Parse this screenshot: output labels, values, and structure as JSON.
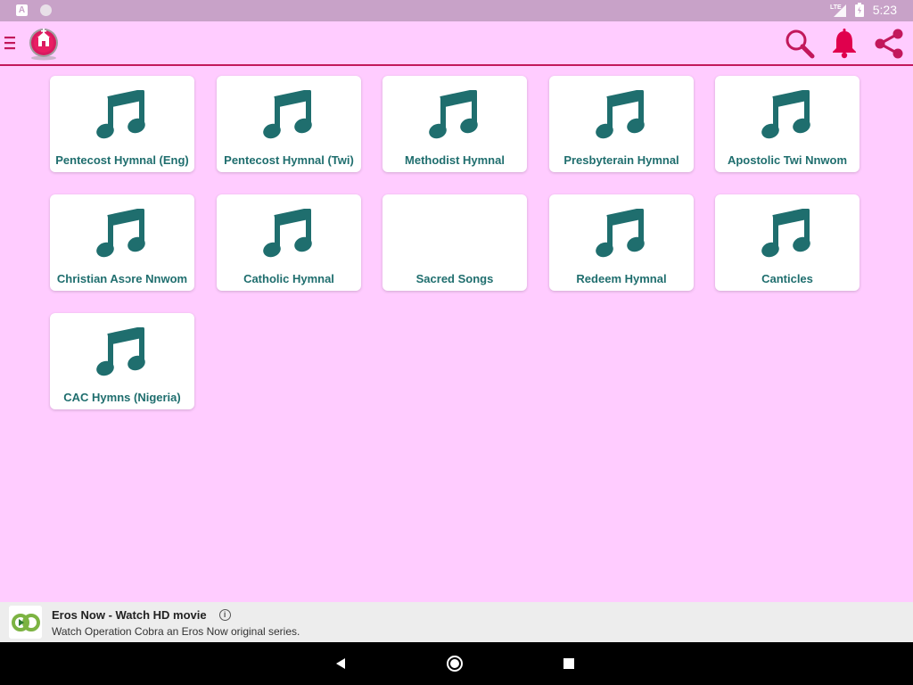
{
  "status_bar": {
    "time": "5:23",
    "network": "LTE",
    "notification_icons": [
      "app-a-icon",
      "circle-notification-icon"
    ]
  },
  "app_bar": {
    "menu_icon": "hamburger-menu-icon",
    "logo_icon": "church-logo-icon",
    "actions": [
      "search-icon",
      "bell-icon",
      "share-icon"
    ]
  },
  "hymnals": [
    {
      "label": "Pentecost Hymnal (Eng)",
      "icon": "music-note-icon"
    },
    {
      "label": "Pentecost Hymnal (Twi)",
      "icon": "music-note-icon"
    },
    {
      "label": "Methodist Hymnal",
      "icon": "music-note-icon"
    },
    {
      "label": "Presbyterain Hymnal",
      "icon": "music-note-icon"
    },
    {
      "label": "Apostolic Twi Nnwom",
      "icon": "music-note-icon"
    },
    {
      "label": "Christian Asɔre Nnwom",
      "icon": "music-note-icon"
    },
    {
      "label": "Catholic Hymnal",
      "icon": "music-note-icon"
    },
    {
      "label": "Sacred Songs",
      "icon": ""
    },
    {
      "label": "Redeem Hymnal",
      "icon": "music-note-icon"
    },
    {
      "label": "Canticles",
      "icon": "music-note-icon"
    },
    {
      "label": "CAC Hymns (Nigeria)",
      "icon": "music-note-icon"
    }
  ],
  "ad": {
    "title": "Eros Now - Watch HD movie",
    "description": "Watch Operation Cobra an Eros Now original series.",
    "info_symbol": "i",
    "logo_icon": "eros-now-logo-icon"
  },
  "nav_bar": {
    "buttons": [
      "back-icon",
      "home-icon",
      "recents-icon"
    ]
  },
  "colors": {
    "background": "#FFCCFF",
    "accent": "#C2185B",
    "label": "#1F6E6E",
    "note": "#1F6E6E",
    "status_bar": "#C8A2C8"
  }
}
